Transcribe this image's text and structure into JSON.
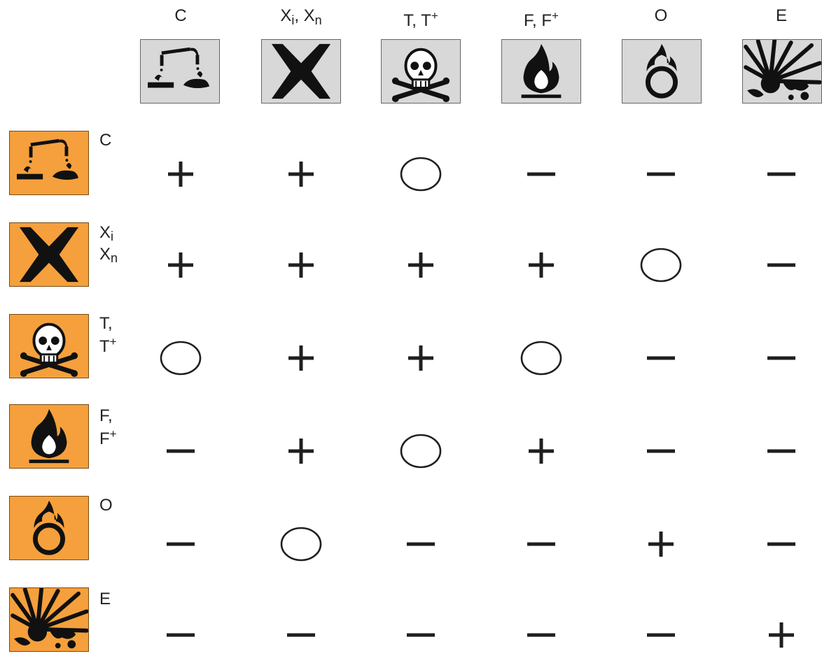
{
  "columns": [
    {
      "main": "C",
      "sub": "",
      "mid": "",
      "sub2": "",
      "sup": "",
      "icon": "corrosive-icon"
    },
    {
      "main": "X",
      "sub": "i",
      "mid": ", X",
      "sub2": "n",
      "sup": "",
      "icon": "harmful-irritant-icon"
    },
    {
      "main": "T, T",
      "sub": "",
      "mid": "",
      "sub2": "",
      "sup": "+",
      "icon": "toxic-skull-icon"
    },
    {
      "main": "F, F",
      "sub": "",
      "mid": "",
      "sub2": "",
      "sup": "+",
      "icon": "flammable-flame-icon"
    },
    {
      "main": "O",
      "sub": "",
      "mid": "",
      "sub2": "",
      "sup": "",
      "icon": "oxidizing-flame-icon"
    },
    {
      "main": "E",
      "sub": "",
      "mid": "",
      "sub2": "",
      "sup": "",
      "icon": "explosive-icon"
    }
  ],
  "rows": [
    {
      "line1": "C",
      "line1_sub": "",
      "line2": "",
      "line2_sub": "",
      "line2_sup": "",
      "icon": "corrosive-icon",
      "cells": [
        "+",
        "+",
        "○",
        "−",
        "−",
        "−"
      ]
    },
    {
      "line1": "X",
      "line1_sub": "i",
      "line2": "X",
      "line2_sub": "n",
      "line2_sup": "",
      "icon": "harmful-irritant-icon",
      "cells": [
        "+",
        "+",
        "+",
        "+",
        "○",
        "−"
      ]
    },
    {
      "line1": "T,",
      "line1_sub": "",
      "line2": "T",
      "line2_sub": "",
      "line2_sup": "+",
      "icon": "toxic-skull-icon",
      "cells": [
        "○",
        "+",
        "+",
        "○",
        "−",
        "−"
      ]
    },
    {
      "line1": "F,",
      "line1_sub": "",
      "line2": "F",
      "line2_sub": "",
      "line2_sup": "+",
      "icon": "flammable-flame-icon",
      "cells": [
        "−",
        "+",
        "○",
        "+",
        "−",
        "−"
      ]
    },
    {
      "line1": "O",
      "line1_sub": "",
      "line2": "",
      "line2_sub": "",
      "line2_sup": "",
      "icon": "oxidizing-flame-icon",
      "cells": [
        "−",
        "○",
        "−",
        "−",
        "+",
        "−"
      ]
    },
    {
      "line1": "E",
      "line1_sub": "",
      "line2": "",
      "line2_sub": "",
      "line2_sup": "",
      "icon": "explosive-icon",
      "cells": [
        "−",
        "−",
        "−",
        "−",
        "−",
        "+"
      ]
    }
  ]
}
